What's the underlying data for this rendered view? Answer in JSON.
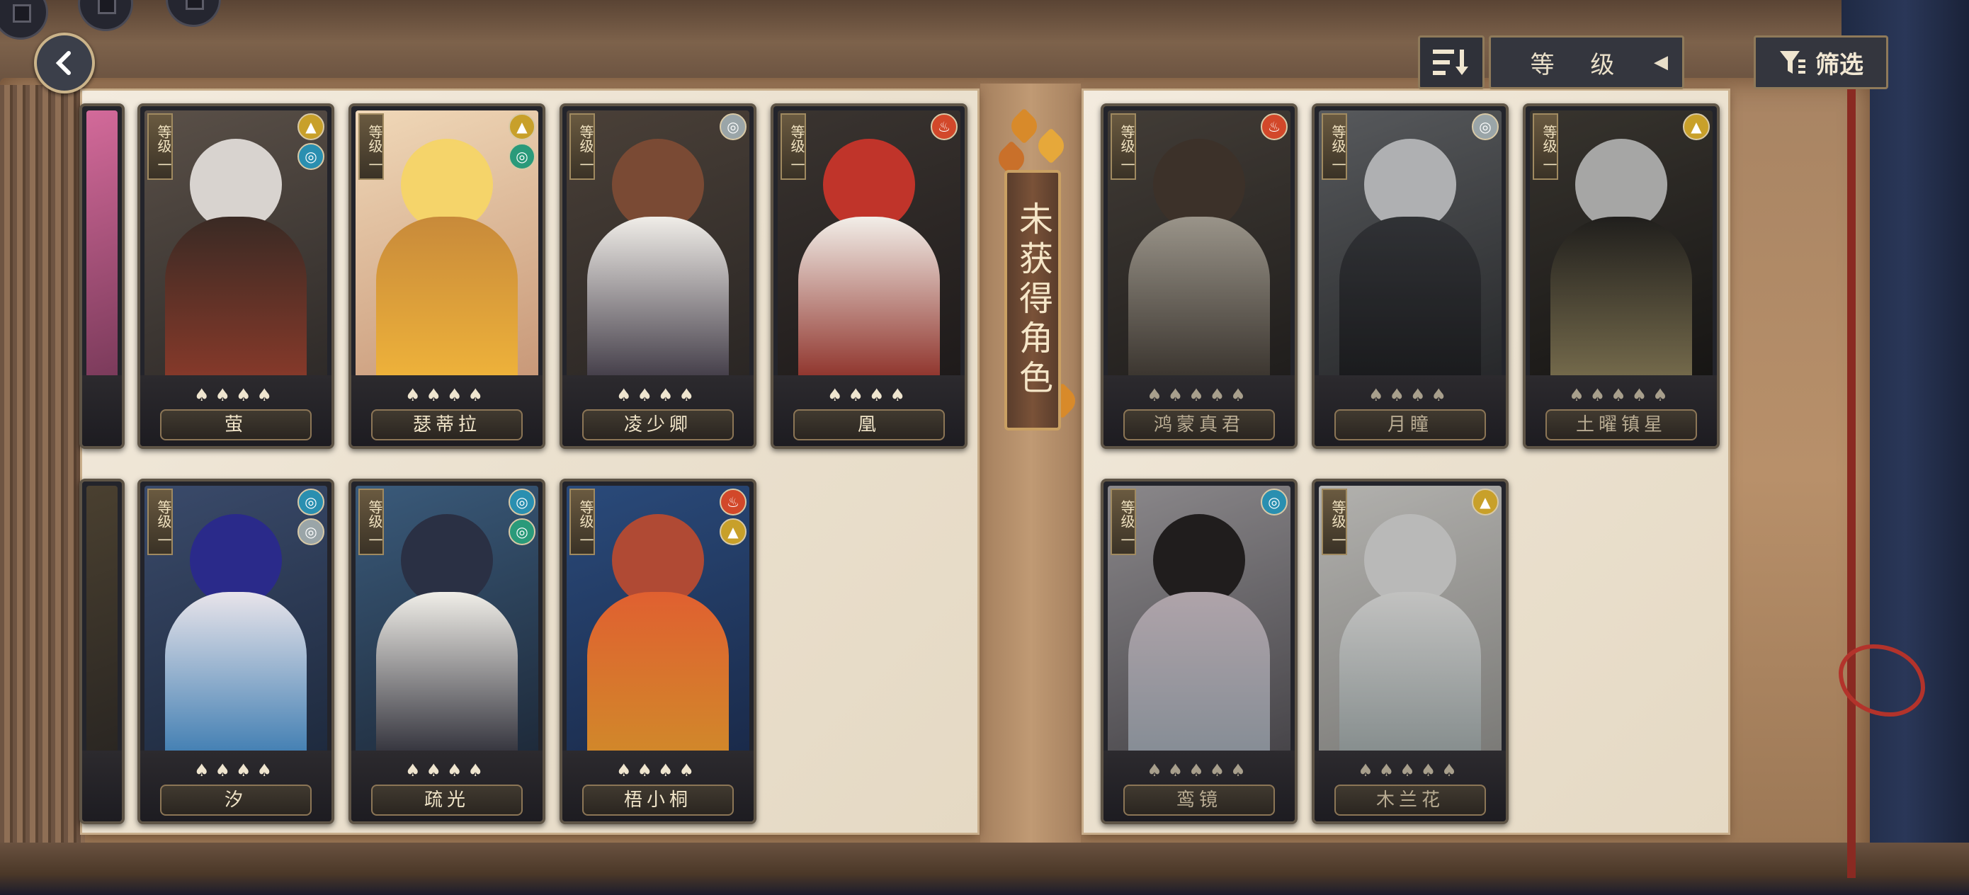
{
  "header": {
    "sort_value": "等 级",
    "filter_label": "筛选"
  },
  "section": {
    "unobtained_label": "未获得角色"
  },
  "cards": {
    "level_label": "等级 一",
    "owned": [
      {
        "name": "萤",
        "stars": "♠♠♠♠",
        "element": "earth",
        "element2": "water"
      },
      {
        "name": "瑟蒂拉",
        "stars": "♠♠♠♠",
        "element": "earth",
        "element2": "wind"
      },
      {
        "name": "凌少卿",
        "stars": "♠♠♠♠",
        "element": "wind",
        "element2": ""
      },
      {
        "name": "凰",
        "stars": "♠♠♠♠",
        "element": "fire",
        "element2": ""
      },
      {
        "name": "汐",
        "stars": "♠♠♠♠",
        "element": "water",
        "element2": "wind"
      },
      {
        "name": "疏光",
        "stars": "♠♠♠♠",
        "element": "water",
        "element2": "wind"
      },
      {
        "name": "梧小桐",
        "stars": "♠♠♠♠",
        "element": "fire",
        "element2": "earth"
      }
    ],
    "locked": [
      {
        "name": "鸿蒙真君",
        "stars": "♠♠♠♠♠",
        "element": "fire"
      },
      {
        "name": "月瞳",
        "stars": "♠♠♠♠",
        "element": "wind"
      },
      {
        "name": "土曜镇星",
        "stars": "♠♠♠♠♠",
        "element": "earth"
      },
      {
        "name": "鸾镜",
        "stars": "♠♠♠♠♠",
        "element": "water"
      },
      {
        "name": "木兰花",
        "stars": "♠♠♠♠♠",
        "element": "earth"
      }
    ]
  },
  "colors": {
    "earth": "#c8a02a",
    "water": "#2a8fb0",
    "wind": "#9aa5a8",
    "fire": "#d2482a"
  },
  "icons": {
    "back": "chevron-left-icon",
    "sort": "sort-order-icon",
    "filter": "filter-icon"
  }
}
